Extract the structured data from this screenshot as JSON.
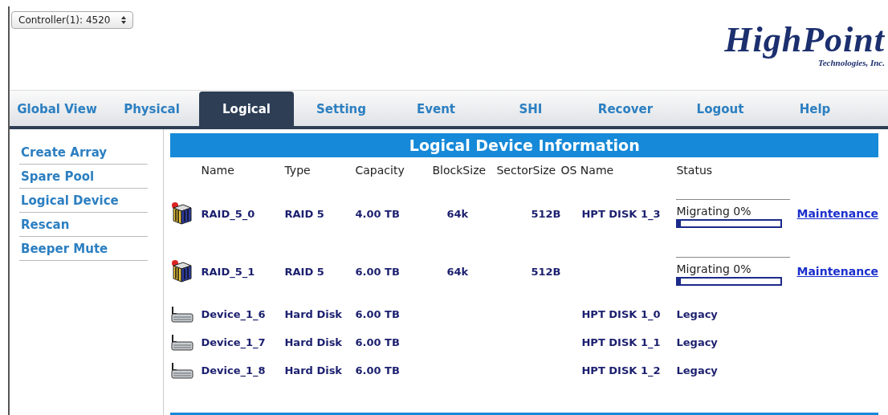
{
  "controller_select": {
    "value": "Controller(1): 4520"
  },
  "logo": {
    "name": "HighPoint",
    "subtitle": "Technologies, Inc."
  },
  "tabs": [
    {
      "label": "Global View",
      "selected": false
    },
    {
      "label": "Physical",
      "selected": false
    },
    {
      "label": "Logical",
      "selected": true
    },
    {
      "label": "Setting",
      "selected": false
    },
    {
      "label": "Event",
      "selected": false
    },
    {
      "label": "SHI",
      "selected": false
    },
    {
      "label": "Recover",
      "selected": false
    },
    {
      "label": "Logout",
      "selected": false
    },
    {
      "label": "Help",
      "selected": false
    }
  ],
  "sidebar": {
    "items": [
      "Create Array",
      "Spare Pool",
      "Logical Device",
      "Rescan",
      "Beeper Mute"
    ]
  },
  "panel": {
    "title": "Logical Device Information",
    "columns": [
      "Name",
      "Type",
      "Capacity",
      "BlockSize",
      "SectorSize",
      "OS Name",
      "Status"
    ],
    "rows": [
      {
        "kind": "array",
        "name": "RAID_5_0",
        "type": "RAID 5",
        "capacity": "4.00 TB",
        "block_size": "64k",
        "sector_size": "512B",
        "os_name": "HPT DISK 1_3",
        "status": "Migrating 0%",
        "level": 0.03,
        "action": "Maintenance"
      },
      {
        "kind": "array",
        "name": "RAID_5_1",
        "type": "RAID 5",
        "capacity": "6.00 TB",
        "block_size": "64k",
        "sector_size": "512B",
        "status": "Migrating 0%",
        "level": 0.03,
        "action": "Maintenance"
      },
      {
        "kind": "disk",
        "name": "Device_1_6",
        "type": "Hard Disk",
        "capacity": "6.00 TB",
        "os_name": "HPT DISK 1_0",
        "status": "Legacy"
      },
      {
        "kind": "disk",
        "name": "Device_1_7",
        "type": "Hard Disk",
        "capacity": "6.00 TB",
        "os_name": "HPT DISK 1_1",
        "status": "Legacy"
      },
      {
        "kind": "disk",
        "name": "Device_1_8",
        "type": "Hard Disk",
        "capacity": "6.00 TB",
        "os_name": "HPT DISK 1_2",
        "status": "Legacy"
      }
    ]
  }
}
